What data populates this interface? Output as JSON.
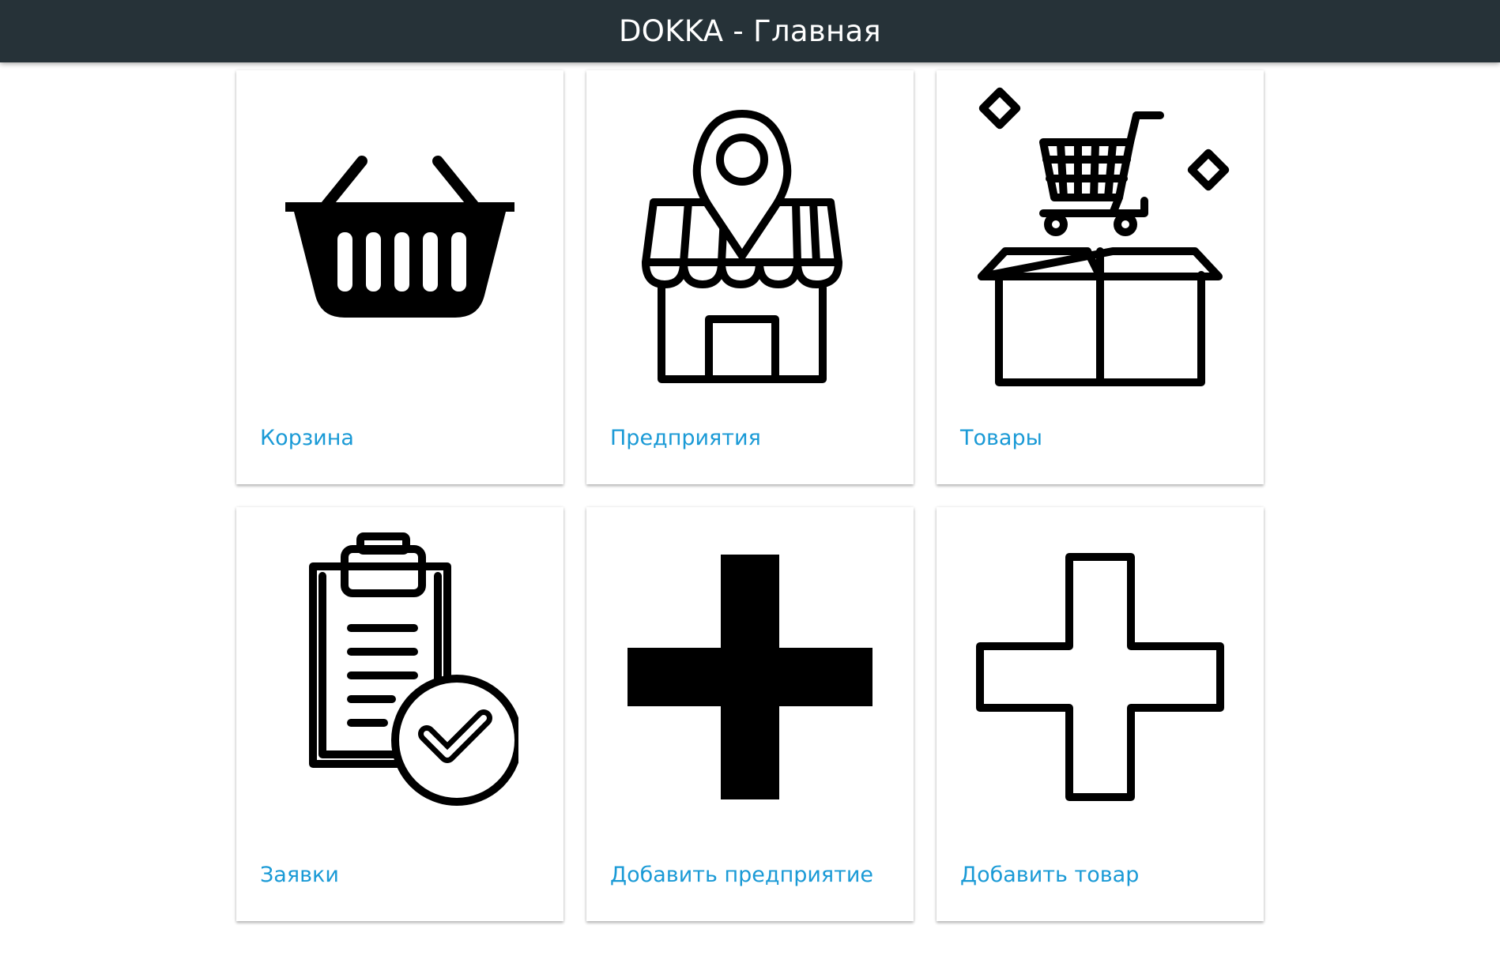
{
  "header": {
    "title": "DOKKA - Главная"
  },
  "cards": [
    {
      "label": "Корзина",
      "icon": "basket-icon"
    },
    {
      "label": "Предприятия",
      "icon": "storefront-location-icon"
    },
    {
      "label": "Товары",
      "icon": "cart-box-icon"
    },
    {
      "label": "Заявки",
      "icon": "clipboard-check-icon"
    },
    {
      "label": "Добавить предприятие",
      "icon": "plus-filled-icon"
    },
    {
      "label": "Добавить товар",
      "icon": "plus-outline-icon"
    }
  ],
  "colors": {
    "header_bg": "#263238",
    "link": "#1a9ad6",
    "page_bg": "#ffffff"
  }
}
